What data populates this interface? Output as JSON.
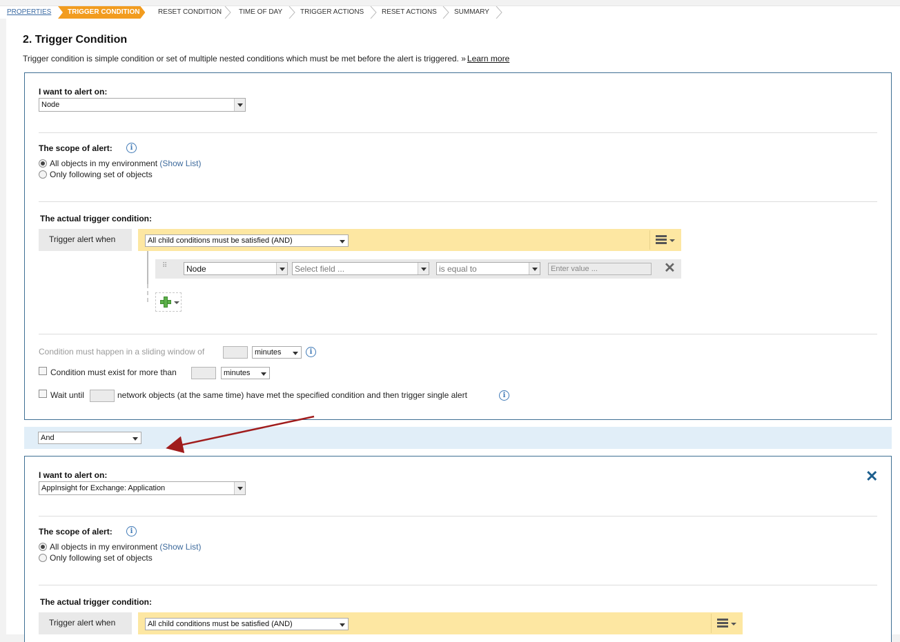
{
  "breadcrumbs": [
    {
      "label": "PROPERTIES",
      "state": "link"
    },
    {
      "label": "TRIGGER CONDITION",
      "state": "active"
    },
    {
      "label": "RESET CONDITION",
      "state": "normal"
    },
    {
      "label": "TIME OF DAY",
      "state": "normal"
    },
    {
      "label": "TRIGGER ACTIONS",
      "state": "normal"
    },
    {
      "label": "RESET ACTIONS",
      "state": "normal"
    },
    {
      "label": "SUMMARY",
      "state": "normal"
    }
  ],
  "section": {
    "title": "2. Trigger Condition",
    "description": "Trigger condition is simple condition or set of multiple nested conditions which must be met before the alert is triggered. »",
    "learn_more": "Learn more"
  },
  "panel1": {
    "alert_on_label": "I want to alert on:",
    "alert_on_value": "Node",
    "scope_label": "The scope of alert:",
    "scope_options": [
      {
        "label": "All objects in my environment",
        "link": "(Show List)",
        "selected": true
      },
      {
        "label": "Only following set of objects",
        "link": "",
        "selected": false
      }
    ],
    "trigger_heading": "The actual trigger condition:",
    "trigger_when_label": "Trigger alert when",
    "trigger_when_value": "All child conditions must be satisfied (AND)",
    "condition": {
      "object": "Node",
      "field_placeholder": "Select field ...",
      "operator": "is equal to",
      "value_placeholder": "Enter value ..."
    },
    "sliding_window": {
      "prefix": "Condition must happen in a sliding window of",
      "unit": "minutes"
    },
    "exist_for": {
      "label": "Condition must exist for more than",
      "unit": "minutes"
    },
    "wait_until": {
      "prefix": "Wait until",
      "suffix": "network objects (at the same time) have met the specified condition and then trigger single alert"
    }
  },
  "logic_operator": "And",
  "panel2": {
    "alert_on_label": "I want to alert on:",
    "alert_on_value": "AppInsight for Exchange: Application",
    "scope_label": "The scope of alert:",
    "scope_options": [
      {
        "label": "All objects in my environment",
        "link": "(Show List)",
        "selected": true
      },
      {
        "label": "Only following set of objects",
        "link": "",
        "selected": false
      }
    ],
    "trigger_heading": "The actual trigger condition:",
    "trigger_when_label": "Trigger alert when",
    "trigger_when_value": "All child conditions must be satisfied (AND)"
  },
  "icons": [
    "info-icon",
    "menu-icon",
    "add-condition-icon",
    "remove-icon",
    "close-icon",
    "drag-handle-icon"
  ],
  "colors": {
    "accent": "#f29c1f",
    "panel_border": "#3d6e93",
    "trigger_bar": "#fde7a2",
    "and_bar": "#e1eef8",
    "arrow": "#a01c1c"
  }
}
